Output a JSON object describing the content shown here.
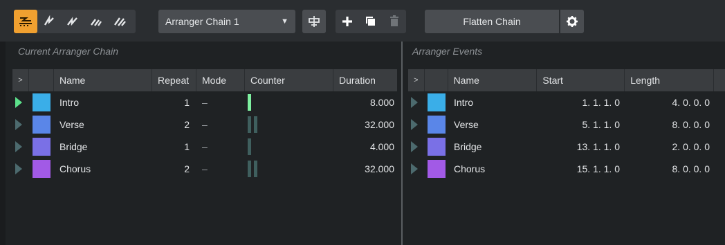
{
  "toolbar": {
    "mode_icons": [
      "arranger-activate-icon",
      "jump-icon-1",
      "jump-icon-2",
      "jump-icon-3",
      "jump-icon-4"
    ],
    "chain_select": {
      "value": "Arranger Chain 1"
    },
    "flatten_label": "Flatten Chain",
    "accent": "#f0a030"
  },
  "left_panel": {
    "title": "Current Arranger Chain",
    "columns": [
      ">",
      "",
      "Name",
      "Repeat",
      "Mode",
      "Counter",
      "Duration"
    ],
    "rows": [
      {
        "name": "Intro",
        "repeat": "1",
        "mode": "–",
        "counter_total": 1,
        "counter_current": 1,
        "duration": "8.000",
        "color": "#3aaee8",
        "playing": true
      },
      {
        "name": "Verse",
        "repeat": "2",
        "mode": "–",
        "counter_total": 2,
        "counter_current": 0,
        "duration": "32.000",
        "color": "#5a86e8",
        "playing": false
      },
      {
        "name": "Bridge",
        "repeat": "1",
        "mode": "–",
        "counter_total": 1,
        "counter_current": 0,
        "duration": "4.000",
        "color": "#7a70e6",
        "playing": false
      },
      {
        "name": "Chorus",
        "repeat": "2",
        "mode": "–",
        "counter_total": 2,
        "counter_current": 0,
        "duration": "32.000",
        "color": "#a25ae6",
        "playing": false
      }
    ]
  },
  "right_panel": {
    "title": "Arranger Events",
    "columns": [
      ">",
      "",
      "Name",
      "Start",
      "Length"
    ],
    "rows": [
      {
        "name": "Intro",
        "start": "1. 1. 1.  0",
        "length": "4. 0. 0.  0",
        "color": "#3aaee8"
      },
      {
        "name": "Verse",
        "start": "5. 1. 1.  0",
        "length": "8. 0. 0.  0",
        "color": "#5a86e8"
      },
      {
        "name": "Bridge",
        "start": "13. 1. 1.  0",
        "length": "2. 0. 0.  0",
        "color": "#7a70e6"
      },
      {
        "name": "Chorus",
        "start": "15. 1. 1.  0",
        "length": "8. 0. 0.  0",
        "color": "#a25ae6"
      }
    ]
  }
}
